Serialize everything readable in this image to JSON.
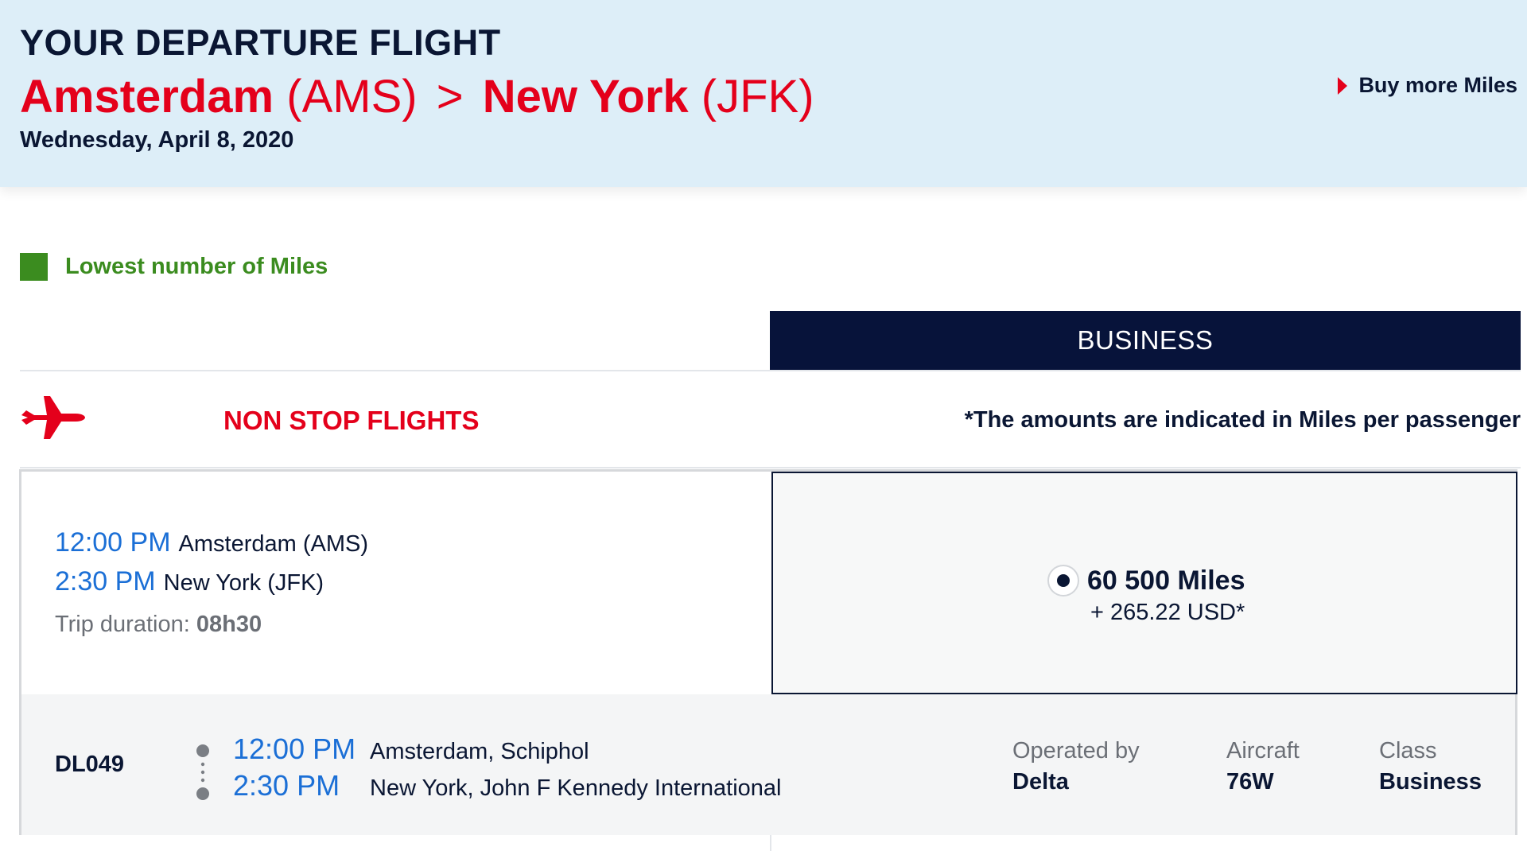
{
  "header": {
    "title": "YOUR DEPARTURE FLIGHT",
    "route": {
      "origin_city": "Amsterdam",
      "origin_code": "(AMS)",
      "separator": ">",
      "destination_city": "New York",
      "destination_code": "(JFK)"
    },
    "date": "Wednesday, April 8, 2020",
    "buy_miles_label": "Buy more Miles"
  },
  "legend": {
    "label": "Lowest number of Miles",
    "color": "#3b8c1f"
  },
  "cabin": {
    "label": "BUSINESS"
  },
  "section": {
    "icon": "airplane-icon",
    "label": "NON STOP FLIGHTS",
    "note": "*The amounts are indicated in Miles per passenger"
  },
  "flight": {
    "departure_time": "12:00 PM",
    "departure_place": "Amsterdam (AMS)",
    "arrival_time": "2:30 PM",
    "arrival_place": "New York (JFK)",
    "duration_label": "Trip duration:",
    "duration_value": "08h30",
    "fare": {
      "miles": "60 500 Miles",
      "cash": "+ 265.22 USD*",
      "selected": true
    },
    "segment": {
      "flight_number": "DL049",
      "departure_time": "12:00 PM",
      "departure_airport": "Amsterdam, Schiphol",
      "arrival_time": "2:30 PM",
      "arrival_airport": "New York, John F Kennedy International",
      "operated_by_label": "Operated by",
      "operated_by_value": "Delta",
      "aircraft_label": "Aircraft",
      "aircraft_value": "76W",
      "class_label": "Class",
      "class_value": "Business"
    }
  },
  "colors": {
    "accent_red": "#e4001b",
    "navy": "#07133a",
    "time_blue": "#1b6fd6",
    "header_bg": "#ddeef8"
  }
}
